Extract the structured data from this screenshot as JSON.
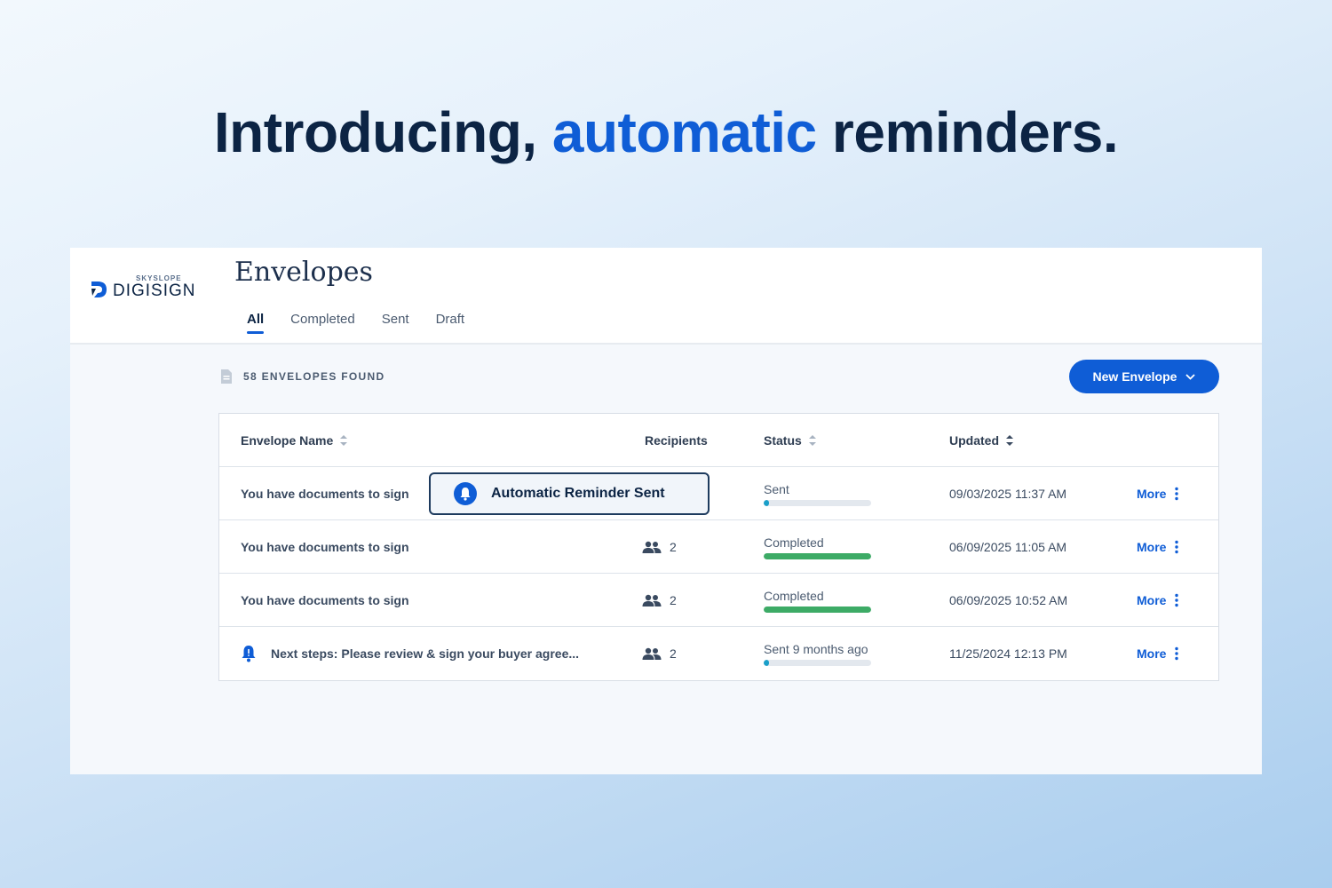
{
  "headline": {
    "before": "Introducing, ",
    "accent": "automatic",
    "after": " reminders."
  },
  "app": {
    "logo_small": "SKYSLOPE",
    "logo_big": "DIGISIGN",
    "page_title": "Envelopes",
    "tabs": [
      {
        "label": "All",
        "active": true
      },
      {
        "label": "Completed",
        "active": false
      },
      {
        "label": "Sent",
        "active": false
      },
      {
        "label": "Draft",
        "active": false
      }
    ],
    "count_text": "58 ENVELOPES FOUND",
    "new_button": "New Envelope",
    "columns": {
      "name": "Envelope Name",
      "recipients": "Recipients",
      "status": "Status",
      "updated": "Updated"
    },
    "reminder_popup": "Automatic Reminder Sent",
    "rows": [
      {
        "name": "You have documents to sign",
        "recipients": "",
        "status": "Sent",
        "progress": 0.05,
        "progress_color": "#1a9fc9",
        "updated": "09/03/2025 11:37 AM",
        "more": "More"
      },
      {
        "name": "You have documents to sign",
        "recipients": "2",
        "status": "Completed",
        "progress": 1.0,
        "progress_color": "#3dab66",
        "updated": "06/09/2025 11:05 AM",
        "more": "More"
      },
      {
        "name": "You have documents to sign",
        "recipients": "2",
        "status": "Completed",
        "progress": 1.0,
        "progress_color": "#3dab66",
        "updated": "06/09/2025 10:52 AM",
        "more": "More"
      },
      {
        "name": "Next steps: Please review & sign your buyer agree...",
        "recipients": "2",
        "status": "Sent 9 months ago",
        "progress": 0.05,
        "progress_color": "#1a9fc9",
        "updated": "11/25/2024 12:13 PM",
        "more": "More"
      }
    ]
  },
  "colors": {
    "accent": "#0f5dd6",
    "navy": "#0c2444",
    "completed": "#3dab66",
    "sent": "#1a9fc9"
  }
}
